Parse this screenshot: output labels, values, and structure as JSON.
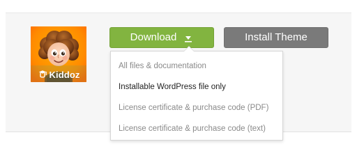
{
  "product": {
    "brand_text": "Kiddoz",
    "brand_icon": "kiddoz-logo-icon"
  },
  "actions": {
    "download_label": "Download",
    "download_icon": "download-arrow-icon",
    "install_label": "Install Theme"
  },
  "dropdown": {
    "items": [
      {
        "label": "All files & documentation"
      },
      {
        "label": "Installable WordPress file only"
      },
      {
        "label": "License certificate & purchase code (PDF)"
      },
      {
        "label": "License certificate & purchase code (text)"
      }
    ]
  },
  "colors": {
    "download_button": "#82b440",
    "install_button": "#7a7a7a",
    "menu_text_muted": "#8a8a8a",
    "menu_text_active": "#1f1f1f"
  }
}
